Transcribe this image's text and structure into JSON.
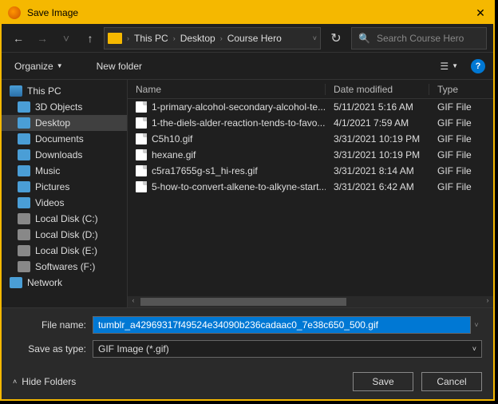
{
  "window": {
    "title": "Save Image"
  },
  "nav": {
    "breadcrumbs": [
      "This PC",
      "Desktop",
      "Course Hero"
    ],
    "search_placeholder": "Search Course Hero"
  },
  "toolbar": {
    "organize": "Organize",
    "new_folder": "New folder",
    "help": "?"
  },
  "sidebar": {
    "items": [
      {
        "label": "This PC",
        "icon": "ic-pc",
        "root": true
      },
      {
        "label": "3D Objects",
        "icon": "ic-3d"
      },
      {
        "label": "Desktop",
        "icon": "ic-desktop",
        "selected": true
      },
      {
        "label": "Documents",
        "icon": "ic-docs"
      },
      {
        "label": "Downloads",
        "icon": "ic-down"
      },
      {
        "label": "Music",
        "icon": "ic-music"
      },
      {
        "label": "Pictures",
        "icon": "ic-pics"
      },
      {
        "label": "Videos",
        "icon": "ic-vids"
      },
      {
        "label": "Local Disk (C:)",
        "icon": "ic-disk"
      },
      {
        "label": "Local Disk (D:)",
        "icon": "ic-disk"
      },
      {
        "label": "Local Disk (E:)",
        "icon": "ic-disk"
      },
      {
        "label": "Softwares (F:)",
        "icon": "ic-disk"
      },
      {
        "label": "Network",
        "icon": "ic-net",
        "root": true
      }
    ]
  },
  "columns": {
    "name": "Name",
    "date": "Date modified",
    "type": "Type"
  },
  "files": [
    {
      "name": "1-primary-alcohol-secondary-alcohol-te...",
      "date": "5/11/2021 5:16 AM",
      "type": "GIF File"
    },
    {
      "name": "1-the-diels-alder-reaction-tends-to-favo...",
      "date": "4/1/2021 7:59 AM",
      "type": "GIF File"
    },
    {
      "name": "C5h10.gif",
      "date": "3/31/2021 10:19 PM",
      "type": "GIF File"
    },
    {
      "name": "hexane.gif",
      "date": "3/31/2021 10:19 PM",
      "type": "GIF File"
    },
    {
      "name": "c5ra17655g-s1_hi-res.gif",
      "date": "3/31/2021 8:14 AM",
      "type": "GIF File"
    },
    {
      "name": "5-how-to-convert-alkene-to-alkyne-start...",
      "date": "3/31/2021 6:42 AM",
      "type": "GIF File"
    }
  ],
  "form": {
    "filename_label": "File name:",
    "filename_value": "tumblr_a42969317f49524e34090b236cadaac0_7e38c650_500.gif",
    "saveas_label": "Save as type:",
    "saveas_value": "GIF Image (*.gif)"
  },
  "actions": {
    "hide_folders": "Hide Folders",
    "save": "Save",
    "cancel": "Cancel"
  }
}
